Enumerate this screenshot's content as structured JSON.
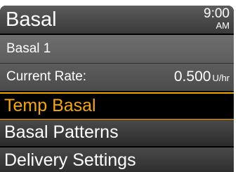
{
  "header": {
    "title": "Basal",
    "time": "9:00",
    "ampm": "AM"
  },
  "info": {
    "pattern_name": "Basal 1",
    "current_rate_label": "Current Rate:",
    "current_rate_value": "0.500",
    "current_rate_unit": "U/hr"
  },
  "menu": {
    "items": [
      {
        "label": "Temp Basal",
        "selected": true
      },
      {
        "label": "Basal Patterns",
        "selected": false
      },
      {
        "label": "Delivery Settings",
        "selected": false
      }
    ]
  },
  "colors": {
    "accent": "#f5a900",
    "background": "#000000",
    "text": "#ffffff"
  }
}
